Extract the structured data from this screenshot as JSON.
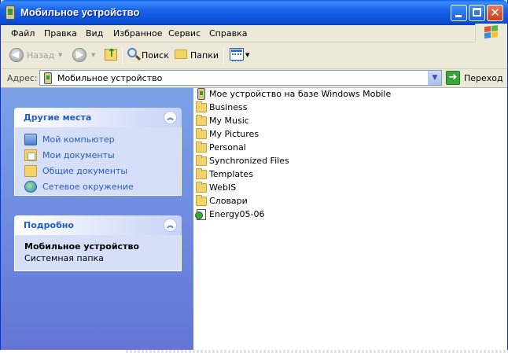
{
  "window": {
    "title": "Мобильное устройство"
  },
  "menubar": {
    "items": [
      "Файл",
      "Правка",
      "Вид",
      "Избранное",
      "Сервис",
      "Справка"
    ]
  },
  "toolbar": {
    "back_label": "Назад",
    "search_label": "Поиск",
    "folders_label": "Папки"
  },
  "addressbar": {
    "label": "Адрес:",
    "value": "Мобильное устройство",
    "go_label": "Переход"
  },
  "taskpane": {
    "places": {
      "title": "Другие места",
      "items": [
        {
          "label": "Мой компьютер",
          "icon": "my-computer-icon"
        },
        {
          "label": "Мои документы",
          "icon": "my-documents-icon"
        },
        {
          "label": "Общие документы",
          "icon": "shared-documents-icon"
        },
        {
          "label": "Сетевое окружение",
          "icon": "network-icon"
        }
      ]
    },
    "details": {
      "title": "Подробно",
      "name": "Мобильное устройство",
      "type": "Системная папка"
    }
  },
  "files": [
    {
      "name": "Мое устройство на базе Windows Mobile",
      "icon": "mobile-device-icon"
    },
    {
      "name": "Business",
      "icon": "folder-icon"
    },
    {
      "name": "My Music",
      "icon": "folder-icon"
    },
    {
      "name": "My Pictures",
      "icon": "folder-icon"
    },
    {
      "name": "Personal",
      "icon": "folder-icon"
    },
    {
      "name": "Synchronized Files",
      "icon": "folder-icon"
    },
    {
      "name": "Templates",
      "icon": "folder-icon"
    },
    {
      "name": "WebIS",
      "icon": "folder-icon"
    },
    {
      "name": "Словари",
      "icon": "folder-icon"
    },
    {
      "name": "Energy05-06",
      "icon": "file-icon"
    }
  ],
  "colors": {
    "titlebar": "#0a4fd6",
    "taskpane_top": "#7ba2e7",
    "taskpane_bottom": "#6375d6",
    "link": "#215dc6"
  }
}
